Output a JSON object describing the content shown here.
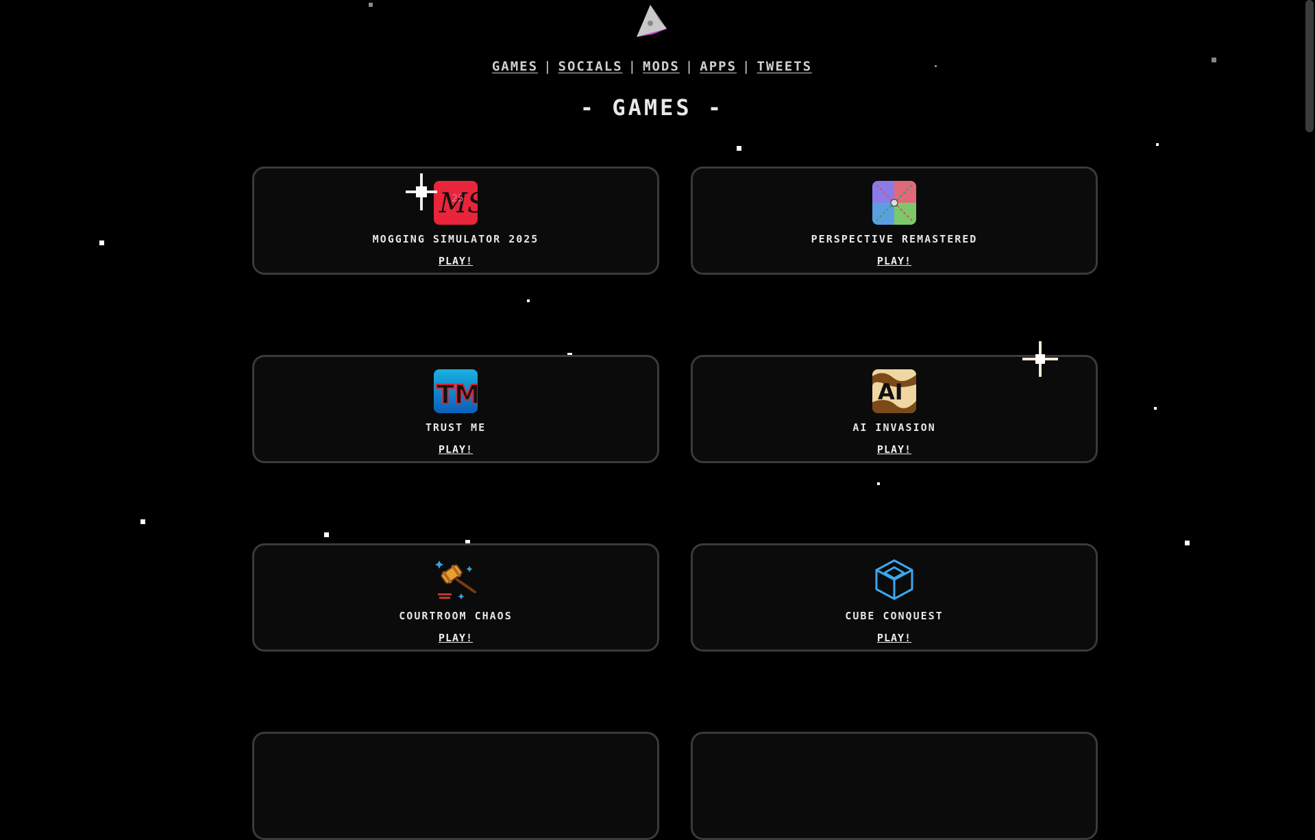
{
  "nav": {
    "items": [
      "GAMES",
      "SOCIALS",
      "MODS",
      "APPS",
      "TWEETS"
    ],
    "separator": "|"
  },
  "section_title": "- GAMES -",
  "games": [
    {
      "title": "MOGGING SIMULATOR 2025",
      "play": "PLAY!",
      "icon": "mogging-simulator-icon"
    },
    {
      "title": "PERSPECTIVE REMASTERED",
      "play": "PLAY!",
      "icon": "perspective-remastered-icon"
    },
    {
      "title": "TRUST ME",
      "play": "PLAY!",
      "icon": "trust-me-icon"
    },
    {
      "title": "AI INVASION",
      "play": "PLAY!",
      "icon": "ai-invasion-icon"
    },
    {
      "title": "COURTROOM CHAOS",
      "play": "PLAY!",
      "icon": "gavel-icon"
    },
    {
      "title": "CUBE CONQUEST",
      "play": "PLAY!",
      "icon": "cube-icon"
    }
  ],
  "icon_text": {
    "mogging": "MS",
    "trust": "TM",
    "ai": "AI"
  },
  "colors": {
    "background": "#000000",
    "card_background": "#0b0b0b",
    "card_border": "#3a3a3a",
    "text": "#e6e6e6"
  }
}
